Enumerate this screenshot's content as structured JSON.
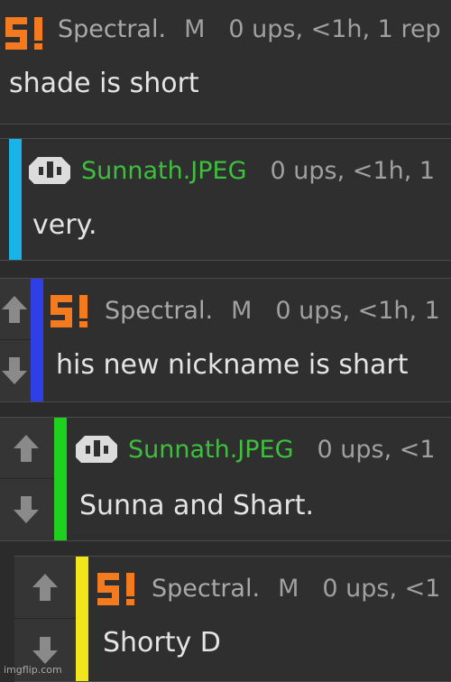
{
  "colors": {
    "background": "#2b2b2b",
    "panel": "#2f2f2f",
    "vote_column": "#353535",
    "username_green": "#3fbe3f",
    "meta_grey": "#a0a0a0",
    "logo_orange": "#f47a1f"
  },
  "thread": [
    {
      "username": "Spectral.",
      "badge": "M",
      "stats": "0 ups, <1h, 1 rep",
      "text": "shade is short",
      "avatar": "spectral-logo-icon",
      "bar_color": ""
    },
    {
      "username": "Sunnath.JPEG",
      "badge": "",
      "stats": "0 ups, <1h, 1",
      "text": "very.",
      "avatar": "sunnath-avatar-icon",
      "bar_color": "#1ab3e8"
    },
    {
      "username": "Spectral.",
      "badge": "M",
      "stats": "0 ups, <1h, 1",
      "text": "his new nickname is shart",
      "avatar": "spectral-logo-icon",
      "bar_color": "#2f3fe8"
    },
    {
      "username": "Sunnath.JPEG",
      "badge": "",
      "stats": "0 ups, <1",
      "text": "Sunna and Shart.",
      "avatar": "sunnath-avatar-icon",
      "bar_color": "#1fd11f"
    },
    {
      "username": "Spectral.",
      "badge": "M",
      "stats": "0 ups, <1",
      "text": "Shorty D",
      "avatar": "spectral-logo-icon",
      "bar_color": "#f2e51c"
    }
  ],
  "vote": {
    "up_icon": "up-arrow-icon",
    "down_icon": "down-arrow-icon"
  },
  "watermark": "imgflip.com"
}
